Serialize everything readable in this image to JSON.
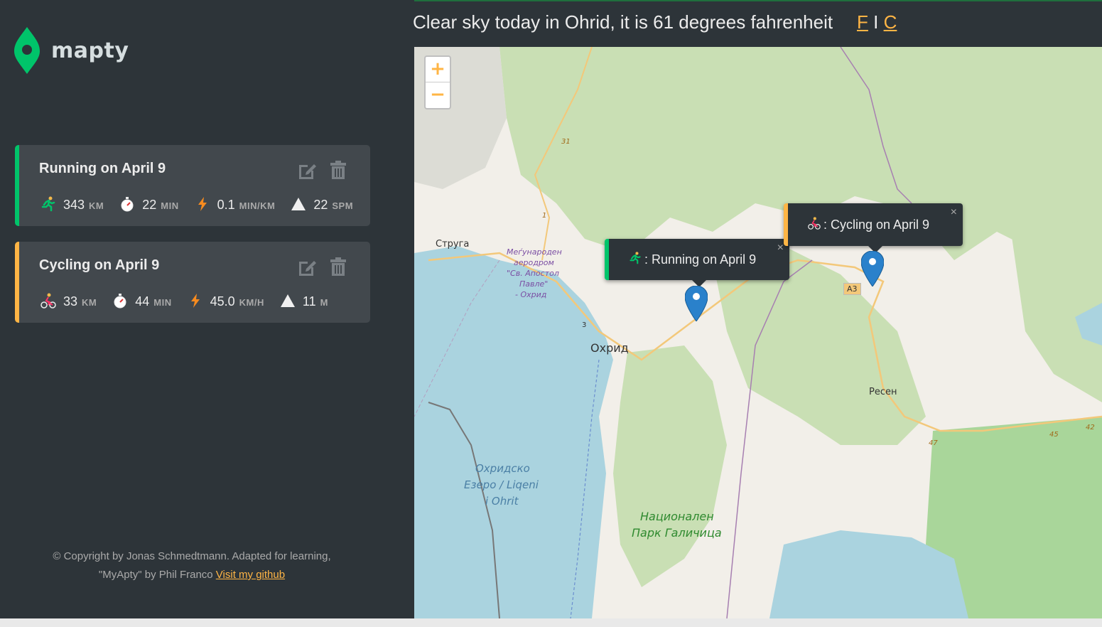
{
  "app": {
    "name": "mapty"
  },
  "weather": {
    "text": "Clear sky today in Ohrid, it is 61 degrees fahrenheit",
    "unit_f": "F",
    "separator": "I",
    "unit_c": "C"
  },
  "workouts": [
    {
      "type": "running",
      "title": "Running on April 9",
      "stats": [
        {
          "icon": "runner-icon",
          "value": "343",
          "unit": "KM"
        },
        {
          "icon": "stopwatch-icon",
          "value": "22",
          "unit": "MIN"
        },
        {
          "icon": "lightning-icon",
          "value": "0.1",
          "unit": "MIN/KM"
        },
        {
          "icon": "mountain-icon",
          "value": "22",
          "unit": "SPM"
        }
      ]
    },
    {
      "type": "cycling",
      "title": "Cycling on April 9",
      "stats": [
        {
          "icon": "cyclist-icon",
          "value": "33",
          "unit": "KM"
        },
        {
          "icon": "stopwatch-icon",
          "value": "44",
          "unit": "MIN"
        },
        {
          "icon": "lightning-icon",
          "value": "45.0",
          "unit": "KM/H"
        },
        {
          "icon": "mountain-icon",
          "value": "11",
          "unit": "M"
        }
      ]
    }
  ],
  "footer": {
    "copyright_line1": "© Copyright by Jonas Schmedtmann. Adapted for learning,",
    "copyright_line2": "\"MyApty\" by Phil Franco",
    "github_link": "Visit my github"
  },
  "map": {
    "zoom_in": "+",
    "zoom_out": "−",
    "popups": [
      {
        "text": ": Running on April 9",
        "close": "×"
      },
      {
        "text": ": Cycling on April 9",
        "close": "×"
      }
    ],
    "labels": {
      "struga": "Струга",
      "airport1": "Меѓународен",
      "airport2": "аеродром",
      "airport3": "\"Св. Апостол",
      "airport4": "Павле\"",
      "airport5": "- Охрид",
      "ohrid": "Охрид",
      "resen": "Ресен",
      "lake1": "Охридско",
      "lake2": "Езеро / Liqeni",
      "lake3": "i Ohrit",
      "park1": "Национален",
      "park2": "Парк Галичица",
      "road_a3": "A3",
      "road_31": "31",
      "road_1": "1",
      "road_3": "3",
      "road_47": "47",
      "road_45": "45",
      "road_42": "42"
    }
  },
  "colors": {
    "running": "#00c46a",
    "cycling": "#ffb545",
    "background": "#2d3439",
    "card": "#42484d",
    "marker": "#2a81cb"
  }
}
